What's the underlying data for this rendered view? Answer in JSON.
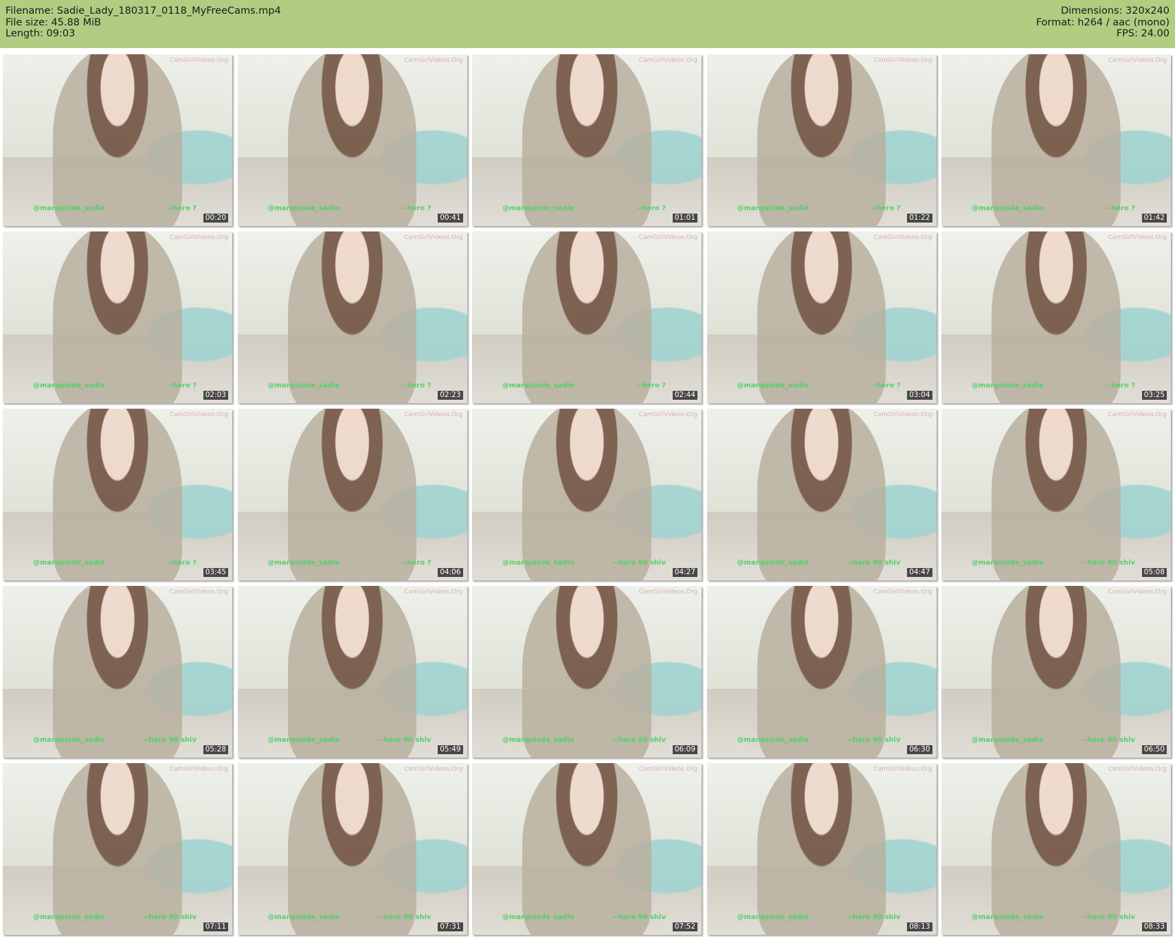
{
  "header": {
    "filename_line": "Filename: Sadie_Lady_180317_0118_MyFreeCams.mp4",
    "filesize_line": "File size: 45.88 MiB",
    "length_line": "Length: 09:03",
    "dimensions_line": "Dimensions: 320x240",
    "format_line": "Format: h264 / aac (mono)",
    "fps_line": "FPS: 24.00"
  },
  "colors": {
    "header_bg": "#b1cd82",
    "caption": "#54d06a"
  },
  "thumbs": [
    {
      "time": "00:20",
      "left": "@marquisde_sadie",
      "right": "~hero ?"
    },
    {
      "time": "00:41",
      "left": "@marquisde_sadie",
      "right": "~hero ?"
    },
    {
      "time": "01:01",
      "left": "@marquisde_sadie",
      "right": "~hero ?"
    },
    {
      "time": "01:22",
      "left": "@marquisde_sadie",
      "right": "~hero ?"
    },
    {
      "time": "01:42",
      "left": "@marquisde_sadie",
      "right": "~hero ?"
    },
    {
      "time": "02:03",
      "left": "@marquisde_sadie",
      "right": "~hero ?"
    },
    {
      "time": "02:23",
      "left": "@marquisde_sadie",
      "right": "~hero ?"
    },
    {
      "time": "02:44",
      "left": "@marquisde_sadie",
      "right": "~hero ?"
    },
    {
      "time": "03:04",
      "left": "@marquisde_sadie",
      "right": "~hero ?"
    },
    {
      "time": "03:25",
      "left": "@marquisde_sadie",
      "right": "~hero ?"
    },
    {
      "time": "03:45",
      "left": "@marquisde_sadie",
      "right": "~hero ?"
    },
    {
      "time": "04:06",
      "left": "@marquisde_sadie",
      "right": "~hero ?"
    },
    {
      "time": "04:27",
      "left": "@marquisde_sadie",
      "right": "~hero 90 shiv"
    },
    {
      "time": "04:47",
      "left": "@marquisde_sadie",
      "right": "~hero 90 shiv"
    },
    {
      "time": "05:08",
      "left": "@marquisde_sadie",
      "right": "~hero 90 shiv"
    },
    {
      "time": "05:28",
      "left": "@marquisde_sadie",
      "right": "~hero 90 shiv"
    },
    {
      "time": "05:49",
      "left": "@marquisde_sadie",
      "right": "~hero 90 shiv"
    },
    {
      "time": "06:09",
      "left": "@marquisde_sadie",
      "right": "~hero 90 shiv"
    },
    {
      "time": "06:30",
      "left": "@marquisde_sadie",
      "right": "~hero 90 shiv"
    },
    {
      "time": "06:50",
      "left": "@marquisde_sadie",
      "right": "~hero 90 shiv"
    },
    {
      "time": "07:11",
      "left": "@marquisde_sadie",
      "right": "~hero 90 shiv"
    },
    {
      "time": "07:31",
      "left": "@marquisde_sadie",
      "right": "~hero 90 shiv"
    },
    {
      "time": "07:52",
      "left": "@marquisde_sadie",
      "right": "~hero 90 shiv"
    },
    {
      "time": "08:13",
      "left": "@marquisde_sadie",
      "right": "~hero 90 shiv"
    },
    {
      "time": "08:33",
      "left": "@marquisde_sadie",
      "right": "~hero 90 shiv"
    }
  ],
  "watermark": "CamGirlVideos.Org"
}
